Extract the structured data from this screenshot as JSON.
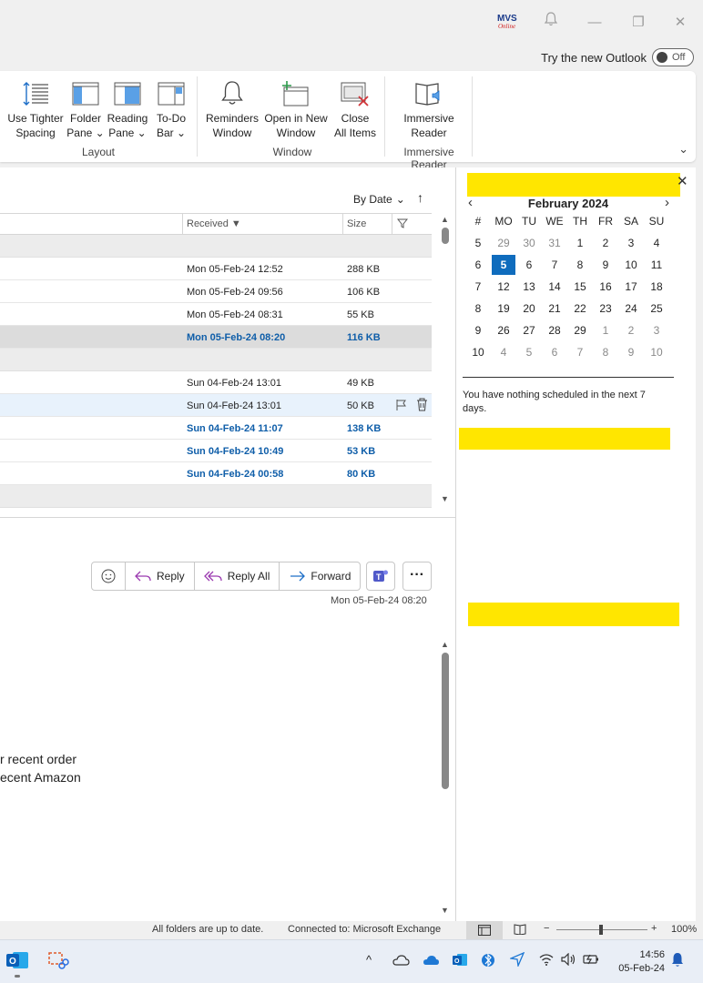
{
  "titlebar": {
    "logo_text": "MVS Online"
  },
  "top": {
    "try_label": "Try the new Outlook",
    "toggle_state": "Off"
  },
  "ribbon": {
    "layout": {
      "label": "Layout",
      "buttons": [
        {
          "l1": "Use Tighter",
          "l2": "Spacing"
        },
        {
          "l1": "Folder",
          "l2": "Pane ⌄"
        },
        {
          "l1": "Reading",
          "l2": "Pane ⌄"
        },
        {
          "l1": "To-Do",
          "l2": "Bar ⌄"
        }
      ]
    },
    "window": {
      "label": "Window",
      "buttons": [
        {
          "l1": "Reminders",
          "l2": "Window"
        },
        {
          "l1": "Open in New",
          "l2": "Window"
        },
        {
          "l1": "Close",
          "l2": "All Items"
        }
      ]
    },
    "immersive": {
      "label": "Immersive Reader",
      "buttons": [
        {
          "l1": "Immersive",
          "l2": "Reader"
        }
      ]
    }
  },
  "list": {
    "sort_label": "By Date",
    "col_received": "Received",
    "col_size": "Size",
    "rows": [
      {
        "received": "Mon 05-Feb-24 12:52",
        "size": "288 KB",
        "unread": false
      },
      {
        "received": "Mon 05-Feb-24 09:56",
        "size": "106 KB",
        "unread": false
      },
      {
        "received": "Mon 05-Feb-24 08:31",
        "size": "55 KB",
        "unread": false
      },
      {
        "received": "Mon 05-Feb-24 08:20",
        "size": "116 KB",
        "unread": true,
        "selected": true
      },
      {
        "received": "Sun 04-Feb-24 13:01",
        "size": "49 KB",
        "unread": false
      },
      {
        "received": "Sun 04-Feb-24 13:01",
        "size": "50 KB",
        "unread": false,
        "hover": true
      },
      {
        "received": "Sun 04-Feb-24 11:07",
        "size": "138 KB",
        "unread": true
      },
      {
        "received": "Sun 04-Feb-24 10:49",
        "size": "53 KB",
        "unread": true
      },
      {
        "received": "Sun 04-Feb-24 00:58",
        "size": "80 KB",
        "unread": true
      }
    ]
  },
  "reading": {
    "reply": "Reply",
    "reply_all": "Reply All",
    "forward": "Forward",
    "date": "Mon 05-Feb-24 08:20",
    "body_line1": "r recent order",
    "body_line2": "ecent Amazon"
  },
  "calendar": {
    "month": "February 2024",
    "headers": [
      "#",
      "MO",
      "TU",
      "WE",
      "TH",
      "FR",
      "SA",
      "SU"
    ],
    "weeks": [
      [
        "5",
        "29",
        "30",
        "31",
        "1",
        "2",
        "3",
        "4"
      ],
      [
        "6",
        "5",
        "6",
        "7",
        "8",
        "9",
        "10",
        "11"
      ],
      [
        "7",
        "12",
        "13",
        "14",
        "15",
        "16",
        "17",
        "18"
      ],
      [
        "8",
        "19",
        "20",
        "21",
        "22",
        "23",
        "24",
        "25"
      ],
      [
        "9",
        "26",
        "27",
        "28",
        "29",
        "1",
        "2",
        "3"
      ],
      [
        "10",
        "4",
        "5",
        "6",
        "7",
        "8",
        "9",
        "10"
      ]
    ],
    "today": "5",
    "nothing_scheduled": "You have nothing scheduled in the next 7 days."
  },
  "status": {
    "sync": "All folders are up to date.",
    "connection": "Connected to: Microsoft Exchange",
    "zoom": "100%"
  },
  "taskbar": {
    "time": "14:56",
    "date": "05-Feb-24"
  }
}
